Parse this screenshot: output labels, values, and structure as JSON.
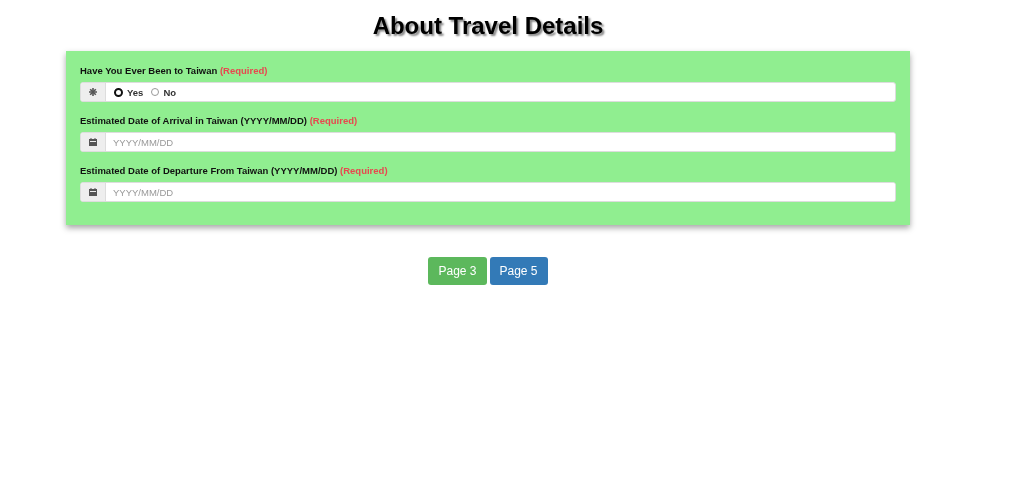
{
  "title": "About Travel Details",
  "fields": [
    {
      "kind": "radio",
      "label": "Have You Ever Been to Taiwan",
      "required": "(Required)",
      "options": [
        {
          "label": "Yes",
          "selected": true
        },
        {
          "label": "No",
          "selected": false
        }
      ]
    },
    {
      "kind": "date",
      "label": "Estimated Date of Arrival in Taiwan (YYYY/MM/DD)",
      "required": "(Required)",
      "placeholder": "YYYY/MM/DD"
    },
    {
      "kind": "date",
      "label": "Estimated Date of Departure From Taiwan (YYYY/MM/DD)",
      "required": "(Required)",
      "placeholder": "YYYY/MM/DD"
    }
  ],
  "buttons": [
    {
      "label": "Page 3",
      "color": "#5cb85c"
    },
    {
      "label": "Page 5",
      "color": "#337ab7"
    }
  ]
}
